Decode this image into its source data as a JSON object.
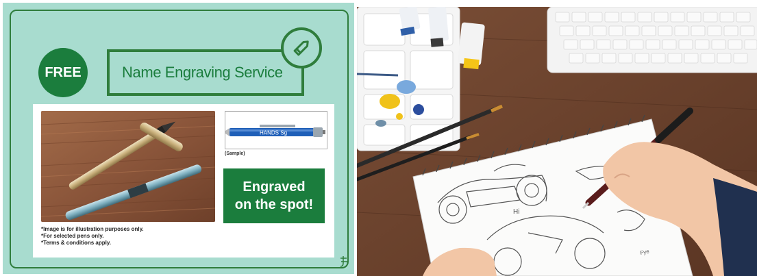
{
  "promo": {
    "badge": "FREE",
    "title": "Name Engraving Service",
    "sample_engraving": "HANDS Sg",
    "sample_label": "(Sample)",
    "engraved_line1": "Engraved",
    "engraved_line2": "on the spot!",
    "notes": [
      "*Image is for illustration purposes only.",
      "*For selected pens only.",
      "*Terms & conditions apply."
    ],
    "colors": {
      "background": "#a8dccf",
      "accent": "#1b7d3d"
    }
  },
  "scene": {
    "sketch_notes": [
      "Hi",
      "Fye"
    ]
  }
}
